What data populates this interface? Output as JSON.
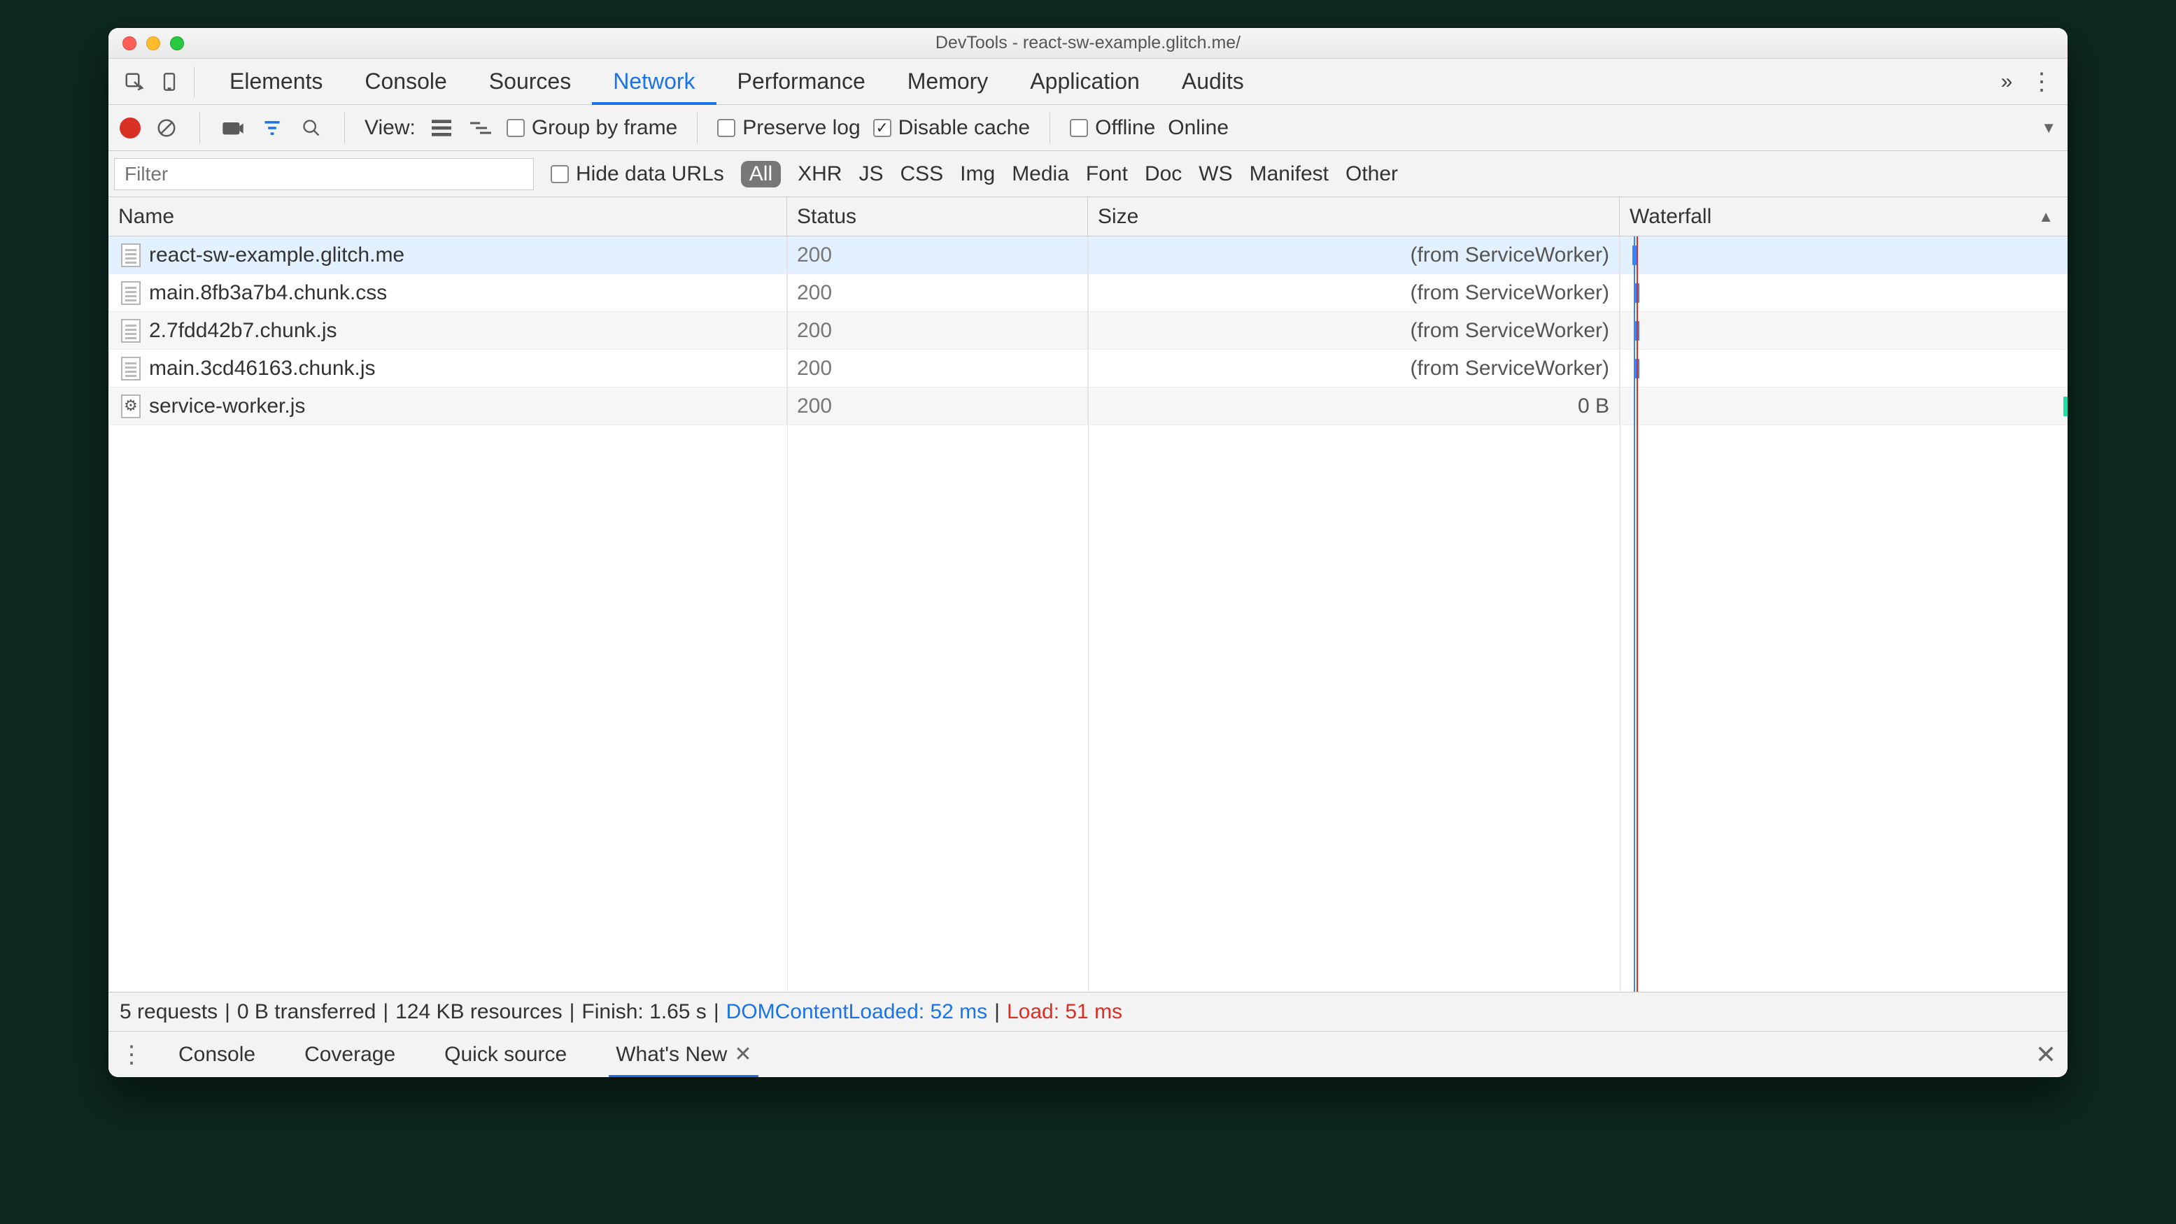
{
  "window": {
    "title": "DevTools - react-sw-example.glitch.me/"
  },
  "mainTabs": {
    "items": [
      "Elements",
      "Console",
      "Sources",
      "Network",
      "Performance",
      "Memory",
      "Application",
      "Audits"
    ],
    "activeIndex": 3
  },
  "toolbar": {
    "viewLabel": "View:",
    "groupByFrame": {
      "label": "Group by frame",
      "checked": false
    },
    "preserveLog": {
      "label": "Preserve log",
      "checked": false
    },
    "disableCache": {
      "label": "Disable cache",
      "checked": true
    },
    "offline": {
      "label": "Offline",
      "checked": false
    },
    "online": {
      "label": "Online"
    }
  },
  "filter": {
    "placeholder": "Filter",
    "hideDataUrls": {
      "label": "Hide data URLs",
      "checked": false
    },
    "types": [
      "All",
      "XHR",
      "JS",
      "CSS",
      "Img",
      "Media",
      "Font",
      "Doc",
      "WS",
      "Manifest",
      "Other"
    ],
    "activeIndex": 0
  },
  "columns": {
    "name": "Name",
    "status": "Status",
    "size": "Size",
    "waterfall": "Waterfall"
  },
  "rows": [
    {
      "name": "react-sw-example.glitch.me",
      "status": "200",
      "size": "(from ServiceWorker)",
      "icon": "doc",
      "selected": true,
      "wf": 4
    },
    {
      "name": "main.8fb3a7b4.chunk.css",
      "status": "200",
      "size": "(from ServiceWorker)",
      "icon": "doc",
      "selected": false,
      "wf": 8
    },
    {
      "name": "2.7fdd42b7.chunk.js",
      "status": "200",
      "size": "(from ServiceWorker)",
      "icon": "doc",
      "selected": false,
      "wf": 8
    },
    {
      "name": "main.3cd46163.chunk.js",
      "status": "200",
      "size": "(from ServiceWorker)",
      "icon": "doc",
      "selected": false,
      "wf": 8
    },
    {
      "name": "service-worker.js",
      "status": "200",
      "size": "0 B",
      "icon": "gear",
      "selected": false,
      "wf": 620,
      "wfColor": "#18e0a6"
    }
  ],
  "summary": {
    "requests": "5 requests",
    "transferred": "0 B transferred",
    "resources": "124 KB resources",
    "finish": "Finish: 1.65 s",
    "dcl": "DOMContentLoaded: 52 ms",
    "load": "Load: 51 ms"
  },
  "drawer": {
    "items": [
      "Console",
      "Coverage",
      "Quick source",
      "What's New"
    ],
    "activeIndex": 3
  }
}
